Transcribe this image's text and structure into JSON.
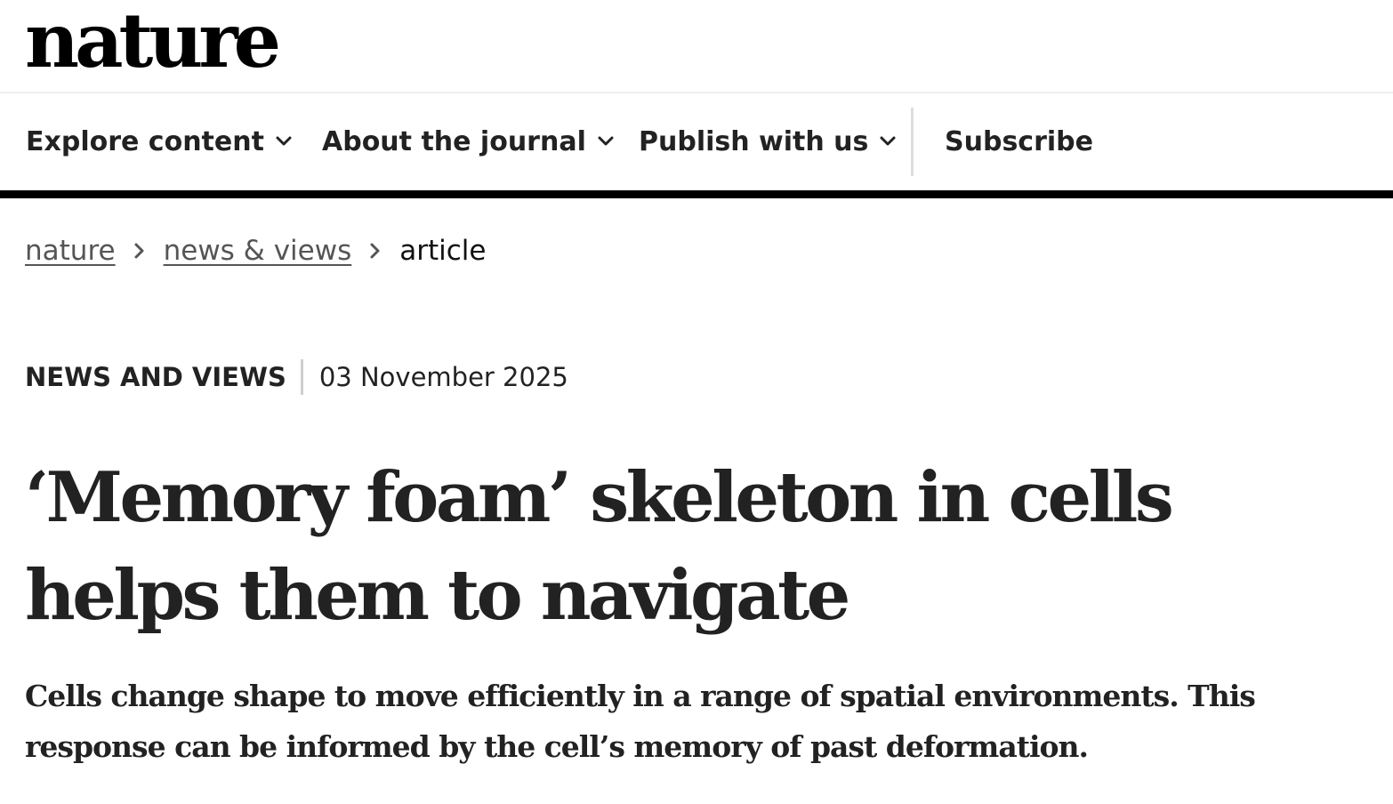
{
  "site": {
    "logo": "nature"
  },
  "nav": {
    "items": [
      {
        "label": "Explore content",
        "icon": "chevron-down-icon"
      },
      {
        "label": "About the journal",
        "icon": "chevron-down-icon"
      },
      {
        "label": "Publish with us",
        "icon": "chevron-down-icon"
      }
    ],
    "subscribe_label": "Subscribe"
  },
  "breadcrumb": {
    "items": [
      "nature",
      "news & views"
    ],
    "current": "article",
    "separator_icon": "chevron-right-icon"
  },
  "article": {
    "type": "NEWS AND VIEWS",
    "date": "03 November 2025",
    "title": "‘Memory foam’ skeleton in cells helps them to navigate",
    "standfirst": "Cells change shape to move efficiently in a range of spatial environments. This response can be informed by the cell’s memory of past deformation."
  },
  "colors": {
    "text": "#222222",
    "nav_rule": "#000000",
    "divider": "#dddddd",
    "breadcrumb_link": "#555555"
  }
}
